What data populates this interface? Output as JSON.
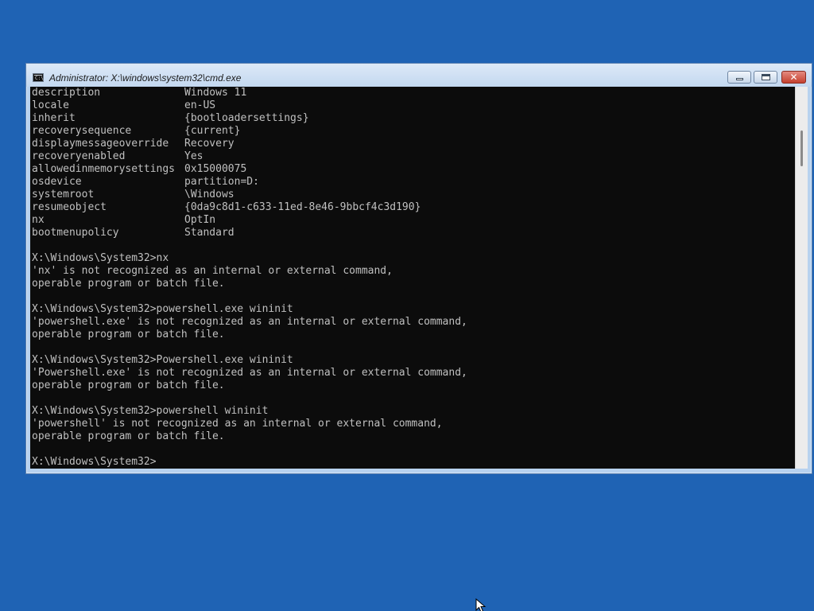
{
  "window": {
    "title": "Administrator: X:\\windows\\system32\\cmd.exe",
    "controls": {
      "minimize": "minimize",
      "maximize": "maximize",
      "close": "close"
    }
  },
  "bcd_entries": [
    {
      "key": "description",
      "value": "Windows 11"
    },
    {
      "key": "locale",
      "value": "en-US"
    },
    {
      "key": "inherit",
      "value": "{bootloadersettings}"
    },
    {
      "key": "recoverysequence",
      "value": "{current}"
    },
    {
      "key": "displaymessageoverride",
      "value": "Recovery"
    },
    {
      "key": "recoveryenabled",
      "value": "Yes"
    },
    {
      "key": "allowedinmemorysettings",
      "value": "0x15000075"
    },
    {
      "key": "osdevice",
      "value": "partition=D:"
    },
    {
      "key": "systemroot",
      "value": "\\Windows"
    },
    {
      "key": "resumeobject",
      "value": "{0da9c8d1-c633-11ed-8e46-9bbcf4c3d190}"
    },
    {
      "key": "nx",
      "value": "OptIn"
    },
    {
      "key": "bootmenupolicy",
      "value": "Standard"
    }
  ],
  "session": [
    "",
    "X:\\Windows\\System32>nx",
    "'nx' is not recognized as an internal or external command,",
    "operable program or batch file.",
    "",
    "X:\\Windows\\System32>powershell.exe wininit",
    "'powershell.exe' is not recognized as an internal or external command,",
    "operable program or batch file.",
    "",
    "X:\\Windows\\System32>Powershell.exe wininit",
    "'Powershell.exe' is not recognized as an internal or external command,",
    "operable program or batch file.",
    "",
    "X:\\Windows\\System32>powershell wininit",
    "'powershell' is not recognized as an internal or external command,",
    "operable program or batch file.",
    ""
  ],
  "prompt": "X:\\Windows\\System32>",
  "colors": {
    "desktop": "#1f63b4",
    "console_bg": "#0c0c0c",
    "console_text": "#c0c0c0",
    "close_button": "#c5412f"
  },
  "icons": {
    "app": "cmd-icon",
    "pointer": "mouse-pointer-icon"
  }
}
